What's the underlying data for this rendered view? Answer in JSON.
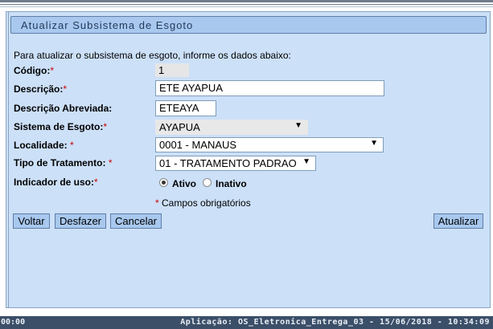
{
  "title": "Atualizar Subsistema de Esgoto",
  "intro": "Para atualizar o subsistema de esgoto, informe os dados abaixo:",
  "form": {
    "codigo_label": "Código:",
    "codigo_value": "1",
    "descricao_label": "Descrição:",
    "descricao_value": "ETE AYAPUA",
    "abreviada_label": "Descrição Abreviada:",
    "abreviada_value": "ETEAYA",
    "sistema_label": "Sistema de Esgoto:",
    "sistema_value": "AYAPUA",
    "localidade_label": "Localidade:",
    "localidade_value": "0001 - MANAUS",
    "tratamento_label": "Tipo de Tratamento:",
    "tratamento_value": "01 - TRATAMENTO PADRAO",
    "indicador_label": "Indicador de uso:",
    "ativo_label": "Ativo",
    "inativo_label": "Inativo",
    "indicador_selected": "Ativo",
    "required_mark": "*",
    "required_note": "Campos obrigatórios"
  },
  "buttons": {
    "voltar": "Voltar",
    "desfazer": "Desfazer",
    "cancelar": "Cancelar",
    "atualizar": "Atualizar"
  },
  "status": {
    "left": "00:00",
    "right": "Aplicação: OS_Eletronica_Entrega_03 - 15/06/2018 - 10:34:09"
  },
  "icons": {
    "dropdown": "chevron-down-icon"
  }
}
